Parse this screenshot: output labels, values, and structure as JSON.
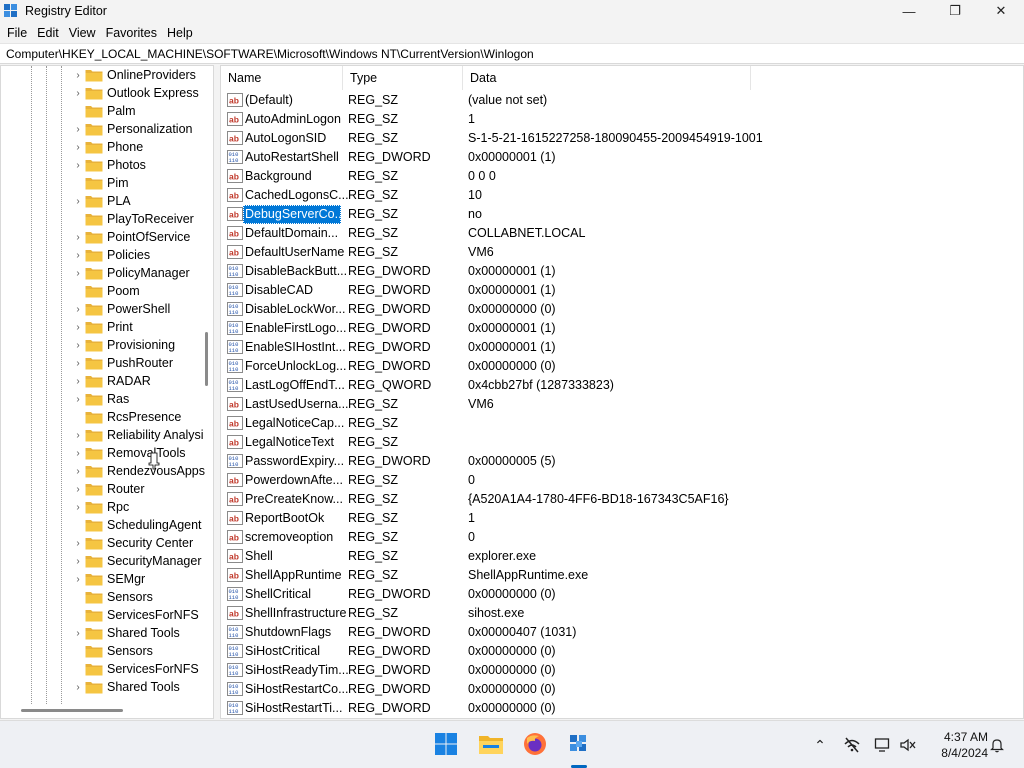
{
  "window": {
    "title": "Registry Editor",
    "minimize": "—",
    "maximize": "❐",
    "close": "✕"
  },
  "menu": [
    "File",
    "Edit",
    "View",
    "Favorites",
    "Help"
  ],
  "address": "Computer\\HKEY_LOCAL_MACHINE\\SOFTWARE\\Microsoft\\Windows NT\\CurrentVersion\\Winlogon",
  "tree": [
    {
      "label": "OnlineProviders",
      "expandable": true
    },
    {
      "label": "Outlook Express",
      "expandable": true
    },
    {
      "label": "Palm",
      "expandable": false
    },
    {
      "label": "Personalization",
      "expandable": true
    },
    {
      "label": "Phone",
      "expandable": true
    },
    {
      "label": "Photos",
      "expandable": true
    },
    {
      "label": "Pim",
      "expandable": false
    },
    {
      "label": "PLA",
      "expandable": true
    },
    {
      "label": "PlayToReceiver",
      "expandable": false
    },
    {
      "label": "PointOfService",
      "expandable": true
    },
    {
      "label": "Policies",
      "expandable": true
    },
    {
      "label": "PolicyManager",
      "expandable": true
    },
    {
      "label": "Poom",
      "expandable": false
    },
    {
      "label": "PowerShell",
      "expandable": true
    },
    {
      "label": "Print",
      "expandable": true
    },
    {
      "label": "Provisioning",
      "expandable": true
    },
    {
      "label": "PushRouter",
      "expandable": true
    },
    {
      "label": "RADAR",
      "expandable": true
    },
    {
      "label": "Ras",
      "expandable": true
    },
    {
      "label": "RcsPresence",
      "expandable": false
    },
    {
      "label": "Reliability Analysi",
      "expandable": true
    },
    {
      "label": "RemovalTools",
      "expandable": true
    },
    {
      "label": "RendezvousApps",
      "expandable": true
    },
    {
      "label": "Router",
      "expandable": true
    },
    {
      "label": "Rpc",
      "expandable": true
    },
    {
      "label": "SchedulingAgent",
      "expandable": false
    },
    {
      "label": "Security Center",
      "expandable": true
    },
    {
      "label": "SecurityManager",
      "expandable": true
    },
    {
      "label": "SEMgr",
      "expandable": true
    },
    {
      "label": "Sensors",
      "expandable": false
    },
    {
      "label": "ServicesForNFS",
      "expandable": false
    },
    {
      "label": "Shared Tools",
      "expandable": true
    },
    {
      "label": "Sensors",
      "expandable": false
    },
    {
      "label": "ServicesForNFS",
      "expandable": false
    },
    {
      "label": "Shared Tools",
      "expandable": true
    }
  ],
  "columns": {
    "name": "Name",
    "type": "Type",
    "data": "Data"
  },
  "values": [
    {
      "icon": "string",
      "name": "(Default)",
      "type": "REG_SZ",
      "data": "(value not set)"
    },
    {
      "icon": "string",
      "name": "AutoAdminLogon",
      "type": "REG_SZ",
      "data": "1"
    },
    {
      "icon": "string",
      "name": "AutoLogonSID",
      "type": "REG_SZ",
      "data": "S-1-5-21-1615227258-180090455-2009454919-1001"
    },
    {
      "icon": "binary",
      "name": "AutoRestartShell",
      "type": "REG_DWORD",
      "data": "0x00000001 (1)"
    },
    {
      "icon": "string",
      "name": "Background",
      "type": "REG_SZ",
      "data": "0 0 0"
    },
    {
      "icon": "string",
      "name": "CachedLogonsC...",
      "type": "REG_SZ",
      "data": "10"
    },
    {
      "icon": "string",
      "name": "DebugServerCo...",
      "type": "REG_SZ",
      "data": "no",
      "selected": true
    },
    {
      "icon": "string",
      "name": "DefaultDomain...",
      "type": "REG_SZ",
      "data": "COLLABNET.LOCAL"
    },
    {
      "icon": "string",
      "name": "DefaultUserName",
      "type": "REG_SZ",
      "data": "VM6"
    },
    {
      "icon": "binary",
      "name": "DisableBackButt...",
      "type": "REG_DWORD",
      "data": "0x00000001 (1)"
    },
    {
      "icon": "binary",
      "name": "DisableCAD",
      "type": "REG_DWORD",
      "data": "0x00000001 (1)"
    },
    {
      "icon": "binary",
      "name": "DisableLockWor...",
      "type": "REG_DWORD",
      "data": "0x00000000 (0)"
    },
    {
      "icon": "binary",
      "name": "EnableFirstLogo...",
      "type": "REG_DWORD",
      "data": "0x00000001 (1)"
    },
    {
      "icon": "binary",
      "name": "EnableSIHostInt...",
      "type": "REG_DWORD",
      "data": "0x00000001 (1)"
    },
    {
      "icon": "binary",
      "name": "ForceUnlockLog...",
      "type": "REG_DWORD",
      "data": "0x00000000 (0)"
    },
    {
      "icon": "binary",
      "name": "LastLogOffEndT...",
      "type": "REG_QWORD",
      "data": "0x4cbb27bf (1287333823)"
    },
    {
      "icon": "string",
      "name": "LastUsedUserna...",
      "type": "REG_SZ",
      "data": "VM6"
    },
    {
      "icon": "string",
      "name": "LegalNoticeCap...",
      "type": "REG_SZ",
      "data": ""
    },
    {
      "icon": "string",
      "name": "LegalNoticeText",
      "type": "REG_SZ",
      "data": ""
    },
    {
      "icon": "binary",
      "name": "PasswordExpiry...",
      "type": "REG_DWORD",
      "data": "0x00000005 (5)"
    },
    {
      "icon": "string",
      "name": "PowerdownAfte...",
      "type": "REG_SZ",
      "data": "0"
    },
    {
      "icon": "string",
      "name": "PreCreateKnow...",
      "type": "REG_SZ",
      "data": "{A520A1A4-1780-4FF6-BD18-167343C5AF16}"
    },
    {
      "icon": "string",
      "name": "ReportBootOk",
      "type": "REG_SZ",
      "data": "1"
    },
    {
      "icon": "string",
      "name": "scremoveoption",
      "type": "REG_SZ",
      "data": "0"
    },
    {
      "icon": "string",
      "name": "Shell",
      "type": "REG_SZ",
      "data": "explorer.exe"
    },
    {
      "icon": "string",
      "name": "ShellAppRuntime",
      "type": "REG_SZ",
      "data": "ShellAppRuntime.exe"
    },
    {
      "icon": "binary",
      "name": "ShellCritical",
      "type": "REG_DWORD",
      "data": "0x00000000 (0)"
    },
    {
      "icon": "string",
      "name": "ShellInfrastructure",
      "type": "REG_SZ",
      "data": "sihost.exe"
    },
    {
      "icon": "binary",
      "name": "ShutdownFlags",
      "type": "REG_DWORD",
      "data": "0x00000407 (1031)"
    },
    {
      "icon": "binary",
      "name": "SiHostCritical",
      "type": "REG_DWORD",
      "data": "0x00000000 (0)"
    },
    {
      "icon": "binary",
      "name": "SiHostReadyTim...",
      "type": "REG_DWORD",
      "data": "0x00000000 (0)"
    },
    {
      "icon": "binary",
      "name": "SiHostRestartCo...",
      "type": "REG_DWORD",
      "data": "0x00000000 (0)"
    },
    {
      "icon": "binary",
      "name": "SiHostRestartTi...",
      "type": "REG_DWORD",
      "data": "0x00000000 (0)"
    }
  ],
  "taskbar": {
    "apps": [
      "windows-start-icon",
      "file-explorer-icon",
      "firefox-icon",
      "registry-editor-icon"
    ],
    "tray": [
      "chevron-up-icon",
      "network-offline-icon",
      "display-icon",
      "volume-icon",
      "notification-bell-icon"
    ],
    "time": "4:37 AM",
    "date": "8/4/2024"
  },
  "colors": {
    "selection": "#0078d7",
    "folder": "#f5c542",
    "accent": "#0067c0"
  }
}
